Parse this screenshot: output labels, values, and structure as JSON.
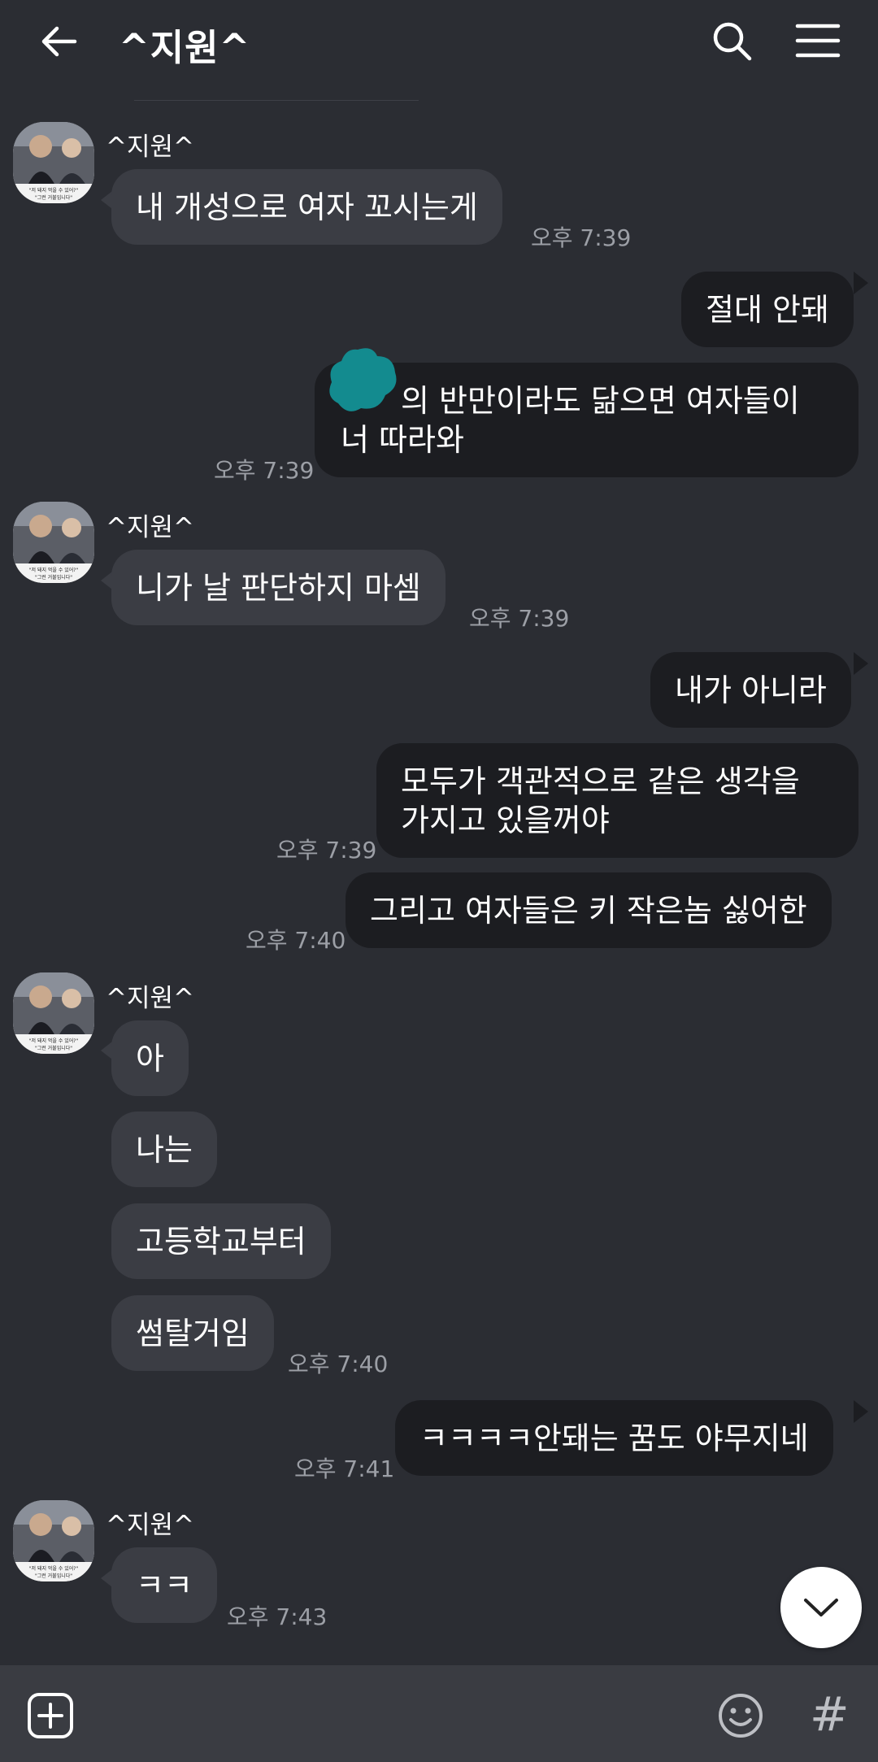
{
  "header": {
    "title": "^지원^",
    "back_icon": "arrow-left-icon",
    "search_icon": "search-icon",
    "menu_icon": "hamburger-menu-icon"
  },
  "messages": [
    {
      "from": "other",
      "sender": "^지원^",
      "text": "내 개성으로 여자 꼬시는게",
      "time": "오후 7:39"
    },
    {
      "from": "me",
      "text": "절대 안돼"
    },
    {
      "from": "me",
      "text": "너의 반만이라도 닮으면 여자들이 너 따라와",
      "line1": "의 반만이라도 닮으면 여자들이",
      "line2": "너 따라와",
      "time": "오후 7:39"
    },
    {
      "from": "other",
      "sender": "^지원^",
      "text": "니가 날 판단하지 마셈",
      "time": "오후 7:39"
    },
    {
      "from": "me",
      "text": "내가 아니라"
    },
    {
      "from": "me",
      "text": "모두가 객관적으로 같은 생각을 가지고 있을꺼야",
      "line1": "모두가 객관적으로 같은 생각을",
      "line2": "가지고 있을꺼야",
      "time": "오후 7:39"
    },
    {
      "from": "me",
      "text": "그리고 여자들은 키 작은놈 싫어한",
      "time": "오후 7:40"
    },
    {
      "from": "other",
      "sender": "^지원^",
      "text": "아"
    },
    {
      "from": "other",
      "text": "나는"
    },
    {
      "from": "other",
      "text": "고등학교부터"
    },
    {
      "from": "other",
      "text": "썸탈거임",
      "time": "오후 7:40"
    },
    {
      "from": "me",
      "text": "ㅋㅋㅋㅋ안돼는 꿈도 야무지네",
      "time": "오후 7:41"
    },
    {
      "from": "other",
      "sender": "^지원^",
      "text": "ㅋㅋ",
      "time": "오후 7:43"
    }
  ],
  "avatar_caption": {
    "line1": "\"저 돼지 먹을 수 있어?\"",
    "line2": "\"그런 거불입니다\""
  },
  "footer": {
    "add_icon": "plus-square-icon",
    "emoji_icon": "smiley-icon",
    "hash_label": "#"
  },
  "colors": {
    "background": "#2b2d33",
    "bubble_other": "#3b3d44",
    "bubble_me": "#1c1d21",
    "sticker": "#138b8f",
    "time_text": "#9c9fa6"
  }
}
